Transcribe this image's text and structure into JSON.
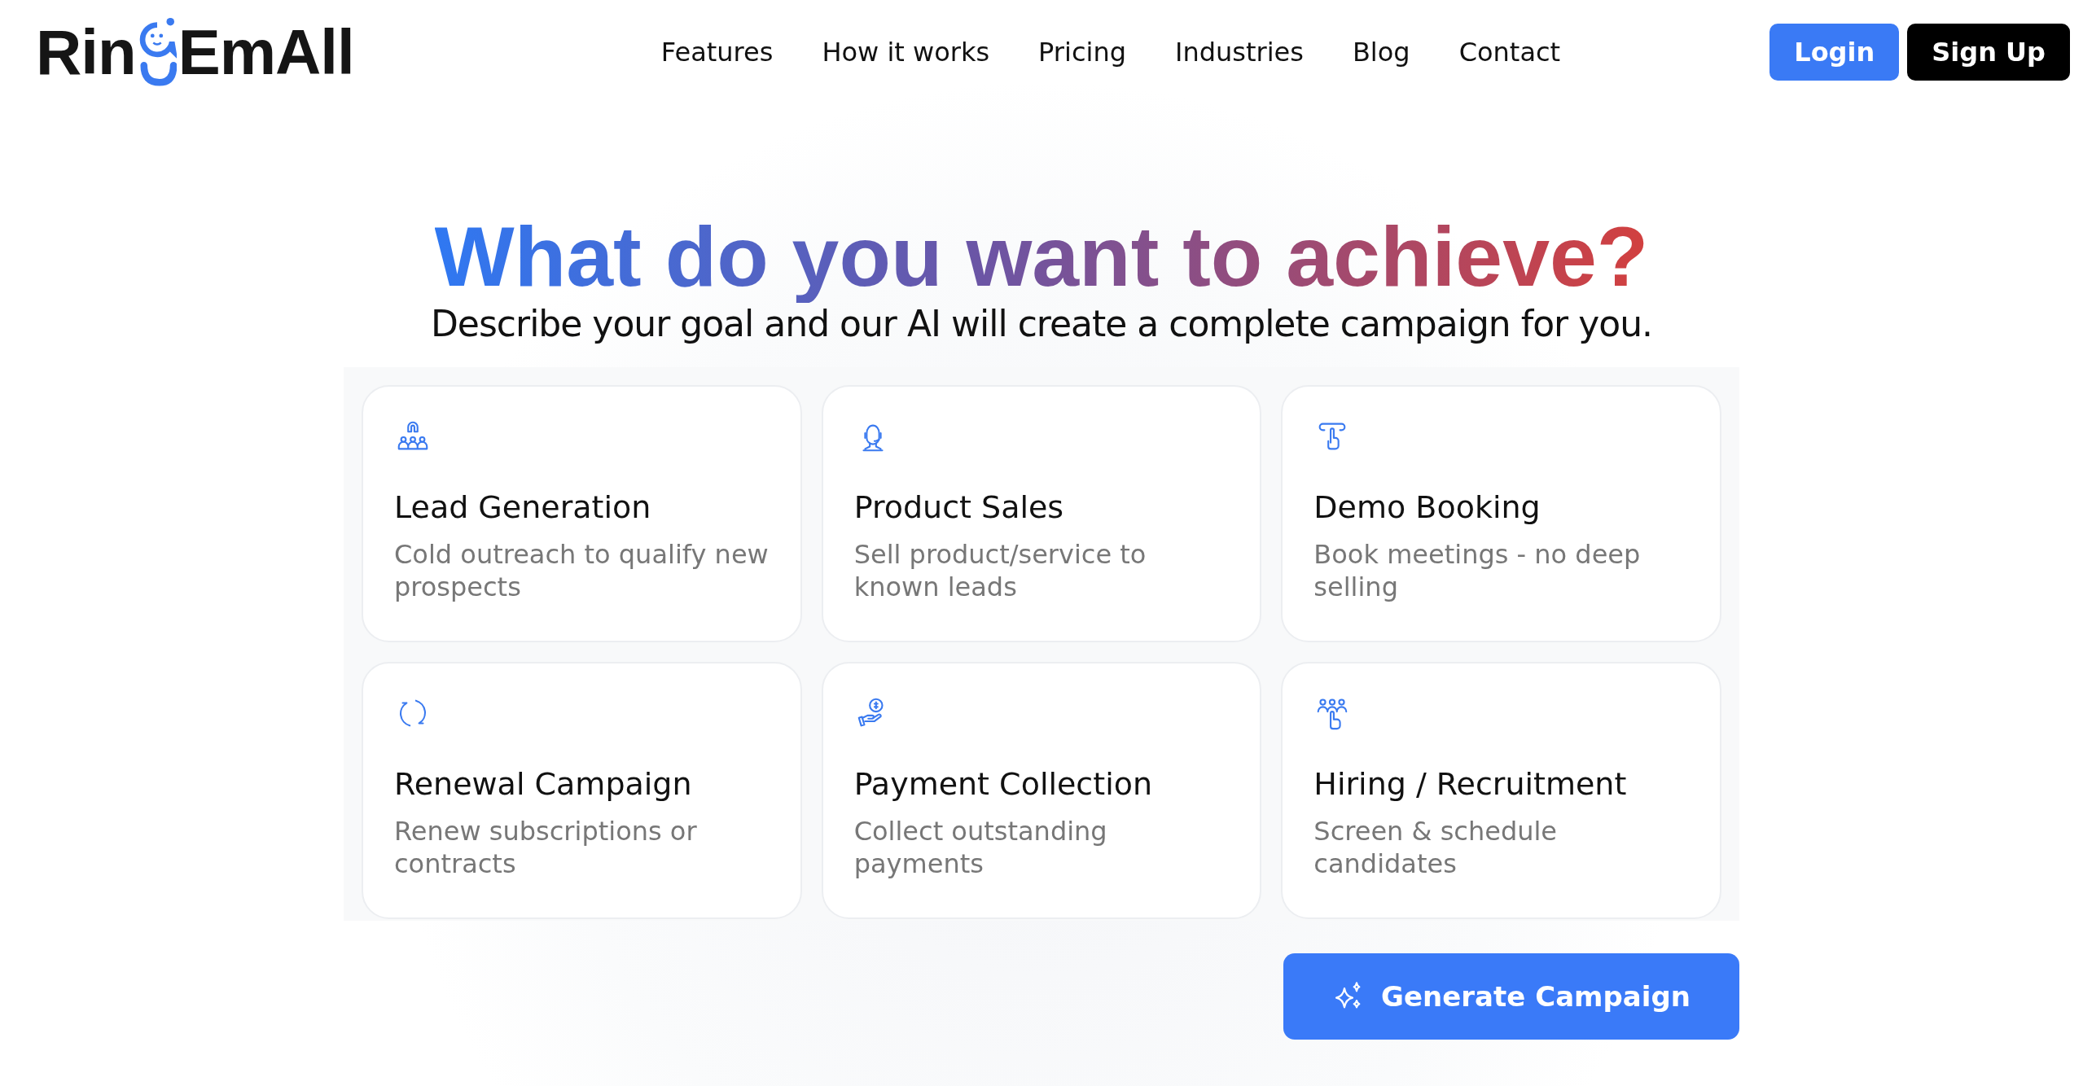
{
  "logo": {
    "before": "Rin",
    "after": "EmAll"
  },
  "nav": [
    "Features",
    "How it works",
    "Pricing",
    "Industries",
    "Blog",
    "Contact"
  ],
  "auth": [
    {
      "label": "Login",
      "kind": "primary"
    },
    {
      "label": "Sign Up",
      "kind": "dark"
    }
  ],
  "heading": "What do you want to achieve?",
  "subtitle": "Describe your goal and our AI will create a complete campaign for you.",
  "goals": [
    {
      "kind": "leads",
      "title": "Lead Generation",
      "description": "Cold outreach to qualify new prospects"
    },
    {
      "kind": "sales",
      "title": "Product Sales",
      "description": "Sell product/service to known leads"
    },
    {
      "kind": "demo",
      "title": "Demo Booking",
      "description": "Book meetings - no deep selling"
    },
    {
      "kind": "renewal",
      "title": "Renewal Campaign",
      "description": "Renew subscriptions or contracts"
    },
    {
      "kind": "payment",
      "title": "Payment Collection",
      "description": "Collect outstanding payments"
    },
    {
      "kind": "hiring",
      "title": "Hiring / Recruitment",
      "description": "Screen & schedule candidates"
    }
  ],
  "generate_button": "Generate Campaign"
}
